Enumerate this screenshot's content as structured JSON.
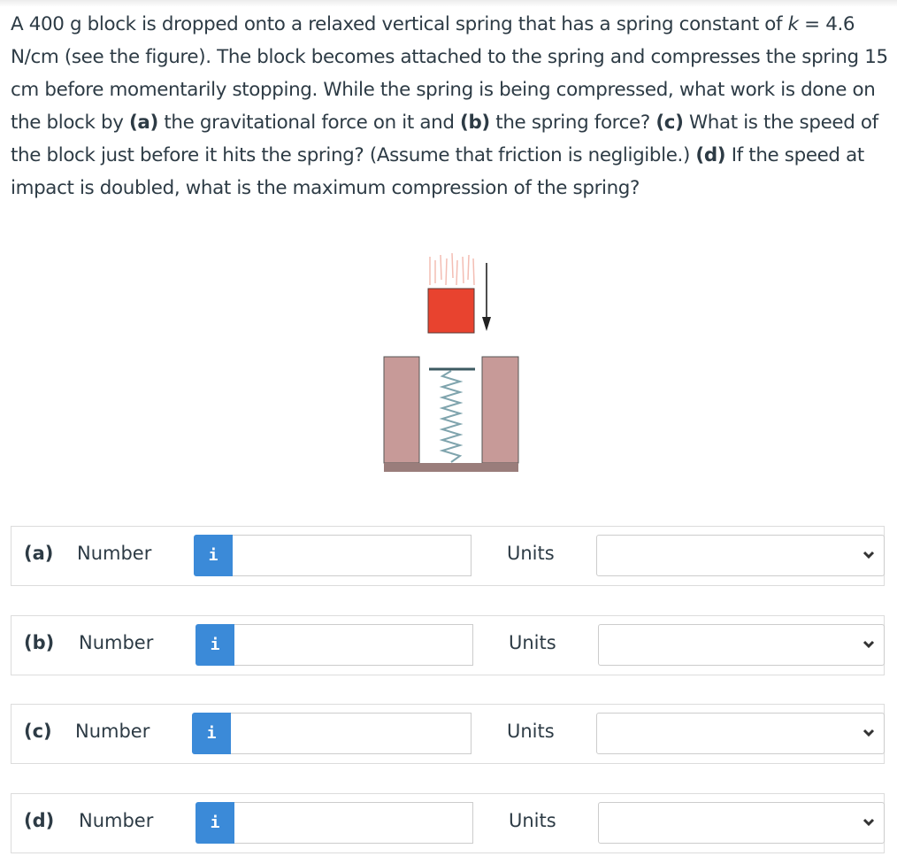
{
  "question": {
    "line1_pre": "A 400 g block is dropped onto a relaxed vertical spring that has a spring constant of ",
    "k_symbol": "k",
    "line2": "= 4.6 N/cm (see the figure). The block becomes attached to the spring and compresses the spring 15 cm before momentarily stopping. While the spring is being compressed, what work is done on the block by ",
    "part_a_marker": "(a)",
    "part_a_text": " the gravitational force on it and ",
    "part_b_marker": "(b)",
    "part_b_text": " the spring force? ",
    "part_c_marker": "(c)",
    "part_c_text": " What is the speed of the block just before it hits the spring? (Assume that friction is negligible.) ",
    "part_d_marker": "(d)",
    "part_d_text": " If the speed at impact is doubled, what is the maximum compression of the spring?"
  },
  "figure": {
    "description": "Block falling onto a vertical spring between two walls",
    "block_color": "#e8432f",
    "wall_color": "#c79a98"
  },
  "answers": [
    {
      "part": "(a)",
      "number_label": "Number",
      "info_icon": "i",
      "value": "",
      "units_label": "Units",
      "units_value": ""
    },
    {
      "part": "(b)",
      "number_label": "Number",
      "info_icon": "i",
      "value": "",
      "units_label": "Units",
      "units_value": ""
    },
    {
      "part": "(c)",
      "number_label": "Number",
      "info_icon": "i",
      "value": "",
      "units_label": "Units",
      "units_value": ""
    },
    {
      "part": "(d)",
      "number_label": "Number",
      "info_icon": "i",
      "value": "",
      "units_label": "Units",
      "units_value": ""
    }
  ],
  "colors": {
    "info_button": "#3b8ad8",
    "text": "#2d3b45",
    "border": "#dcdcdc"
  }
}
